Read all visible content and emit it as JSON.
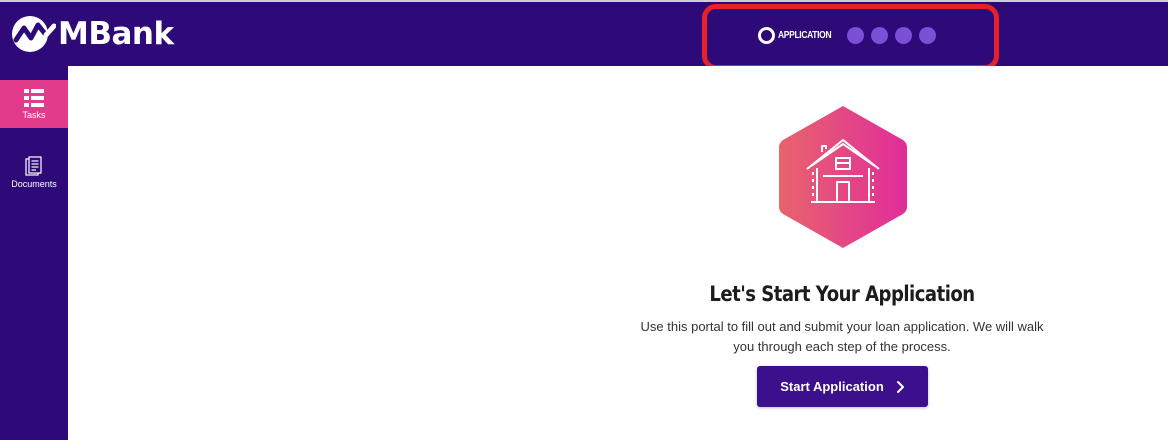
{
  "brand": {
    "name": "MBank",
    "logo_icon": "mbank-logo-icon"
  },
  "progress": {
    "current_step_label": "APPLICATION",
    "remaining_steps": 4,
    "colors": {
      "current": "#ffffff",
      "upcoming": "#7b4fd6"
    }
  },
  "sidebar": {
    "items": [
      {
        "label": "Tasks",
        "icon": "list-icon",
        "active": true
      },
      {
        "label": "Documents",
        "icon": "documents-icon",
        "active": false
      }
    ]
  },
  "main": {
    "hero_icon": "house-icon",
    "title": "Let's Start Your Application",
    "description": "Use this portal to fill out and submit your loan application. We will walk you through each step of the process.",
    "button_label": "Start Application"
  },
  "colors": {
    "header_bg": "#2d0a78",
    "accent_pink": "#e13c8c",
    "button_bg": "#3c0f8c",
    "highlight": "#e8202a"
  }
}
